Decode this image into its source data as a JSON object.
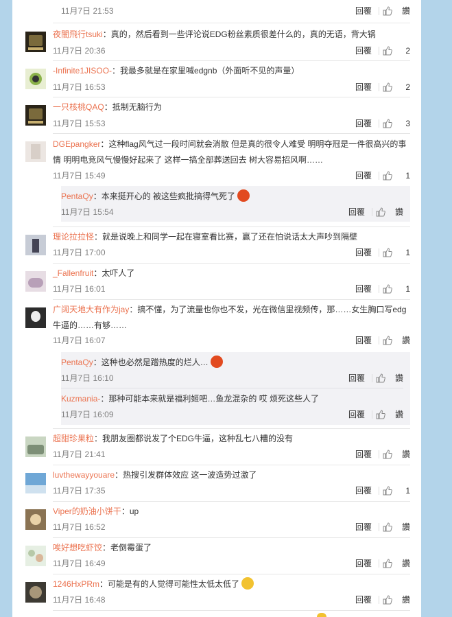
{
  "labels": {
    "reply": "回覆",
    "like_placeholder": "讚"
  },
  "top": {
    "time": "11月7日 21:53",
    "like": "讚"
  },
  "comments": [
    {
      "user": "夜闇飛行tsuki",
      "text": "：真的，然后看到一些评论说EDG粉丝素质很差什么的，真的无语，背大锅",
      "time": "11月7日 20:36",
      "likes": "2"
    },
    {
      "user": "-Infinite1JISOO-",
      "text": "：我最多就是在家里喊edgnb（外面听不见的声量）",
      "time": "11月7日 16:53",
      "likes": "2"
    },
    {
      "user": "一只核桃QAQ",
      "text": "：抵制无脑行为",
      "time": "11月7日 15:53",
      "likes": "3"
    },
    {
      "user": "DGEpangker",
      "text1": "：这种flag风气过一段时间就会消散  但是真的很令人难受 明明夺冠是一件很高兴的事",
      "text2": "情 明明电竞风气慢慢好起来了 这样一搞全部葬送回去 树大容易招风啊……",
      "time": "11月7日 15:49",
      "likes": "1",
      "reply": {
        "user": "PentaQy",
        "text": "：本来挺开心的 被这些疯批搞得气死了",
        "time": "11月7日 15:54",
        "like": "讚"
      }
    },
    {
      "user": "理论拉拉怪",
      "text": "：就是说晚上和同学一起在寝室看比赛，赢了还在怕说话太大声吵到隔壁",
      "time": "11月7日 17:00",
      "likes": "1"
    },
    {
      "user": "_Fallenfruit",
      "text": "：太吓人了",
      "time": "11月7日 16:01",
      "likes": "1"
    },
    {
      "user": "广阔天地大有作为jay",
      "text1": "：搞不懂，为了流量也你也不发，光在微信里视频传，那……女生胸口写edg",
      "text2": "牛逼的……有够……",
      "time": "11月7日 16:07",
      "likes": "讚",
      "replies": [
        {
          "user": "PentaQy",
          "text": "：这种也必然是蹭热度的烂人…",
          "time": "11月7日 16:10",
          "like": "讚"
        },
        {
          "user": "Kuzmania-",
          "text": "：那种可能本来就是福利姬吧…鱼龙混杂的 哎 烦死这些人了",
          "time": "11月7日 16:09",
          "like": "讚"
        }
      ]
    },
    {
      "user": "超甜珍果粒",
      "text": "：我朋友圈都说发了个EDG牛逼，这种乱七八糟的没有",
      "time": "11月7日 21:41",
      "likes": "讚"
    },
    {
      "user": "luvthewayyouare",
      "text": "：热搜引发群体效应 这一波造势过激了",
      "time": "11月7日 17:35",
      "likes": "1"
    },
    {
      "user": "Viper的奶油小饼干",
      "text": "：up",
      "time": "11月7日 16:52",
      "likes": "讚"
    },
    {
      "user": "唉好想吃虾饺",
      "text": "：老倒霉蛋了",
      "time": "11月7日 16:49",
      "likes": "讚"
    },
    {
      "user": "1246HxPRm",
      "text": "：可能是有的人觉得可能性太低太低了",
      "time": "11月7日 16:48",
      "likes": "讚"
    }
  ]
}
